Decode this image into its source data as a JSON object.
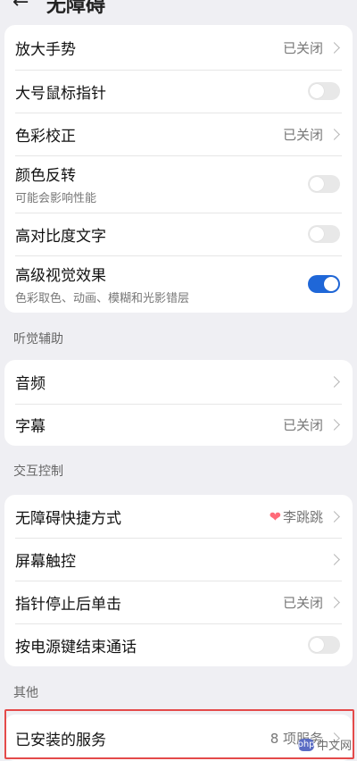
{
  "top": {
    "back_icon": "arrow-left-icon",
    "title": "无障碍"
  },
  "visual": [
    {
      "label": "放大手势",
      "value": "已关闭",
      "type": "link"
    },
    {
      "label": "大号鼠标指针",
      "type": "toggle",
      "on": false
    },
    {
      "label": "色彩校正",
      "value": "已关闭",
      "type": "link"
    },
    {
      "label": "颜色反转",
      "sub": "可能会影响性能",
      "type": "toggle",
      "on": false
    },
    {
      "label": "高对比度文字",
      "type": "toggle",
      "on": false
    },
    {
      "label": "高级视觉效果",
      "sub": "色彩取色、动画、模糊和光影错层",
      "type": "toggle",
      "on": true
    }
  ],
  "hearing": {
    "header": "听觉辅助",
    "items": [
      {
        "label": "音频",
        "type": "link"
      },
      {
        "label": "字幕",
        "value": "已关闭",
        "type": "link"
      }
    ]
  },
  "interaction": {
    "header": "交互控制",
    "items": [
      {
        "label": "无障碍快捷方式",
        "value": "李跳跳",
        "icon": "heart-icon",
        "type": "link"
      },
      {
        "label": "屏幕触控",
        "type": "link"
      },
      {
        "label": "指针停止后单击",
        "value": "已关闭",
        "type": "link"
      },
      {
        "label": "按电源键结束通话",
        "type": "toggle",
        "on": false
      }
    ]
  },
  "other": {
    "header": "其他",
    "items": [
      {
        "label": "已安装的服务",
        "value": "8 项服务",
        "type": "link"
      }
    ]
  },
  "watermark": {
    "logo": "php",
    "text": "中文网"
  },
  "colors": {
    "accent": "#1f67d8",
    "highlight": "#e44a4a",
    "heart": "#ff6b79"
  }
}
